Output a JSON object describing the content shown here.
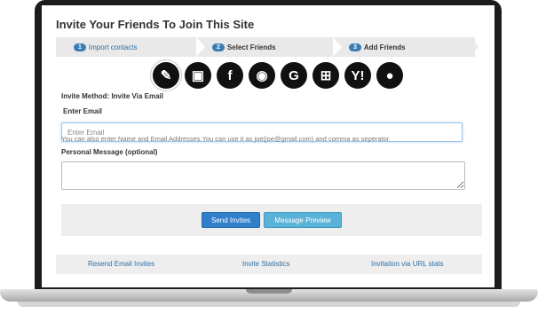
{
  "page": {
    "title": "Invite Your Friends To Join This Site"
  },
  "steps": [
    {
      "num": "1",
      "label": "Import contacts"
    },
    {
      "num": "2",
      "label": "Select Friends"
    },
    {
      "num": "3",
      "label": "Add Friends"
    }
  ],
  "providers": [
    {
      "icon": "pencil-icon",
      "glyph": "✎"
    },
    {
      "icon": "address-book-icon",
      "glyph": "▣"
    },
    {
      "icon": "facebook-icon",
      "glyph": "f"
    },
    {
      "icon": "rss-icon",
      "glyph": "◉"
    },
    {
      "icon": "google-icon",
      "glyph": "G"
    },
    {
      "icon": "windows-icon",
      "glyph": "⊞"
    },
    {
      "icon": "yahoo-icon",
      "glyph": "Y!"
    },
    {
      "icon": "flickr-icon",
      "glyph": "●"
    }
  ],
  "form": {
    "method_label": "Invite Method: Invite Via Email",
    "email_label": "Enter Email",
    "email_placeholder": "Enter Email",
    "email_hint": "You can also enter Name and Email Addresses.You can use it as joe(joe@gmail.com) and comma as seperator",
    "message_label": "Personal Message (optional)"
  },
  "buttons": {
    "send": "Send Invites",
    "preview": "Message Preview"
  },
  "footer": {
    "resend": "Resend Email Invites",
    "stats": "Invite Statistics",
    "url": "Invitation via URL stats"
  }
}
